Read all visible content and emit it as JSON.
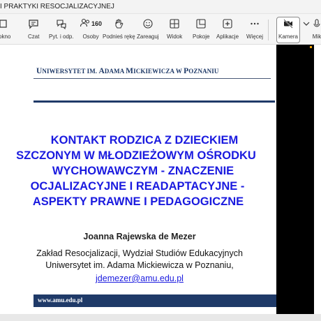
{
  "window": {
    "title": "I PRAKTYKI RESOCJALIZACYJNEJ"
  },
  "toolbar": {
    "items": [
      {
        "label": "okno",
        "icon": "window-icon"
      },
      {
        "label": "Czat",
        "icon": "chat-icon"
      },
      {
        "label": "Pyt. i odp.",
        "icon": "qa-icon"
      },
      {
        "label": "Osoby",
        "icon": "people-icon",
        "count": "160"
      },
      {
        "label": "Podnieś rękę",
        "icon": "raise-hand-icon"
      },
      {
        "label": "Zareaguj",
        "icon": "react-icon"
      },
      {
        "label": "Widok",
        "icon": "view-icon"
      },
      {
        "label": "Pokoje",
        "icon": "rooms-icon"
      },
      {
        "label": "Aplikacje",
        "icon": "apps-icon"
      },
      {
        "label": "Więcej",
        "icon": "more-icon"
      },
      {
        "label": "Kamera",
        "icon": "camera-off-icon"
      },
      {
        "label": "Mik",
        "icon": "microphone-icon"
      }
    ]
  },
  "slide": {
    "university_header_1": "U",
    "university_header_2": "NIWERSYTET IM. ",
    "university_header_3": "A",
    "university_header_4": "DAMA ",
    "university_header_5": "M",
    "university_header_6": "ICKIEWICZA W ",
    "university_header_7": "P",
    "university_header_8": "OZNANIU",
    "title_lines": [
      "KONTAKT RODZICA Z DZIECKIEM",
      "SZCZONYM W MŁODZIEŻOWYM OŚRODKU",
      "WYCHOWAWCZYM - ZNACZENIE",
      "OCJALIZACYJNE I READAPTACYJNE -",
      "ASPEKTY PRAWNE I PEDAGOGICZNE"
    ],
    "author": "Joanna Rajewska de Mezer",
    "affiliation_1": "Zakład Resocjalizacji, Wydział Studiów Edukacyjnych",
    "affiliation_2": "Uniwersytet im.  Adama Mickiewicza w Poznaniu,",
    "email": "jdemezer@amu.edu.pl",
    "footer_url": "www.amu.edu.pl"
  },
  "colors": {
    "title_blue": "#1a1adf",
    "navy": "#1f3a68",
    "video_bg": "#000000"
  }
}
